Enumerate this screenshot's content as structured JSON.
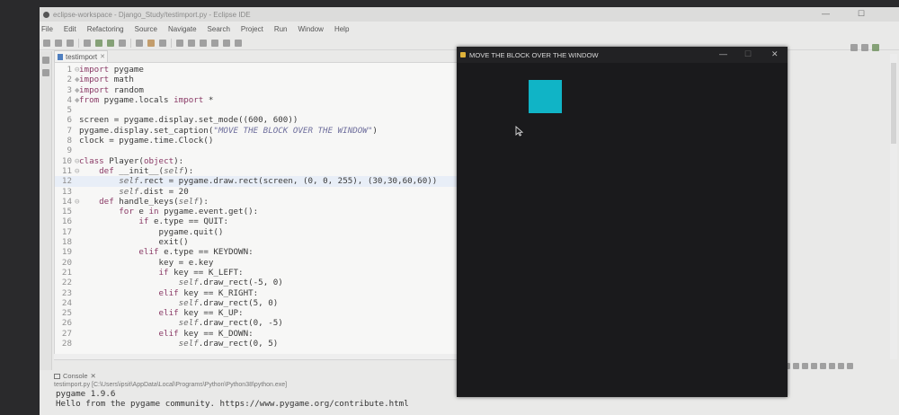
{
  "window": {
    "title": "eclipse-workspace - Django_Study/testimport.py - Eclipse IDE"
  },
  "menu": [
    "File",
    "Edit",
    "Refactoring",
    "Source",
    "Navigate",
    "Search",
    "Project",
    "Run",
    "Window",
    "Help"
  ],
  "editor": {
    "tab_label": "testimport",
    "tab_close": "✕",
    "lines": [
      {
        "n": "1",
        "m": "⊖",
        "t": "import pygame"
      },
      {
        "n": "2",
        "m": "◆",
        "t": "import math"
      },
      {
        "n": "3",
        "m": "◆",
        "t": "import random"
      },
      {
        "n": "4",
        "m": "◆",
        "t": "from pygame.locals import *"
      },
      {
        "n": "5",
        "m": "",
        "t": ""
      },
      {
        "n": "6",
        "m": "",
        "t": "screen = pygame.display.set_mode((600, 600))"
      },
      {
        "n": "7",
        "m": "",
        "t": "pygame.display.set_caption(\"MOVE THE BLOCK OVER THE WINDOW\")"
      },
      {
        "n": "8",
        "m": "",
        "t": "clock = pygame.time.Clock()"
      },
      {
        "n": "9",
        "m": "",
        "t": ""
      },
      {
        "n": "10",
        "m": "⊖",
        "t": "class Player(object):"
      },
      {
        "n": "11",
        "m": "⊖",
        "t": "    def __init__(self):"
      },
      {
        "n": "12",
        "m": "",
        "t": "        self.rect = pygame.draw.rect(screen, (0, 0, 255), (30,30,60,60))",
        "hl": true
      },
      {
        "n": "13",
        "m": "",
        "t": "        self.dist = 20"
      },
      {
        "n": "14",
        "m": "⊖",
        "t": "    def handle_keys(self):"
      },
      {
        "n": "15",
        "m": "",
        "t": "        for e in pygame.event.get():"
      },
      {
        "n": "16",
        "m": "",
        "t": "            if e.type == QUIT:"
      },
      {
        "n": "17",
        "m": "",
        "t": "                pygame.quit()"
      },
      {
        "n": "18",
        "m": "",
        "t": "                exit()"
      },
      {
        "n": "19",
        "m": "",
        "t": "            elif e.type == KEYDOWN:"
      },
      {
        "n": "20",
        "m": "",
        "t": "                key = e.key"
      },
      {
        "n": "21",
        "m": "",
        "t": "                if key == K_LEFT:"
      },
      {
        "n": "22",
        "m": "",
        "t": "                    self.draw_rect(-5, 0)"
      },
      {
        "n": "23",
        "m": "",
        "t": "                elif key == K_RIGHT:"
      },
      {
        "n": "24",
        "m": "",
        "t": "                    self.draw_rect(5, 0)"
      },
      {
        "n": "25",
        "m": "",
        "t": "                elif key == K_UP:"
      },
      {
        "n": "26",
        "m": "",
        "t": "                    self.draw_rect(0, -5)"
      },
      {
        "n": "27",
        "m": "",
        "t": "                elif key == K_DOWN:"
      },
      {
        "n": "28",
        "m": "",
        "t": "                    self.draw_rect(0, 5)"
      }
    ]
  },
  "console": {
    "tab_label": "Console",
    "tab_close": "✕",
    "path": "testimport.py [C:\\Users\\ipsit\\AppData\\Local\\Programs\\Python\\Python38\\python.exe]",
    "output": [
      "pygame 1.9.6",
      "Hello from the pygame community. https://www.pygame.org/contribute.html"
    ]
  },
  "pygame_window": {
    "title": "MOVE THE BLOCK OVER THE WINDOW",
    "minimize": "—",
    "maximize": "☐",
    "close": "✕",
    "block_color": "#10b4c6"
  },
  "window_controls": {
    "minimize": "—",
    "maximize": "☐"
  },
  "colors": {
    "keyword": "#8a3a66",
    "self": "#6b6b6b",
    "string": "#6e6e9c"
  }
}
